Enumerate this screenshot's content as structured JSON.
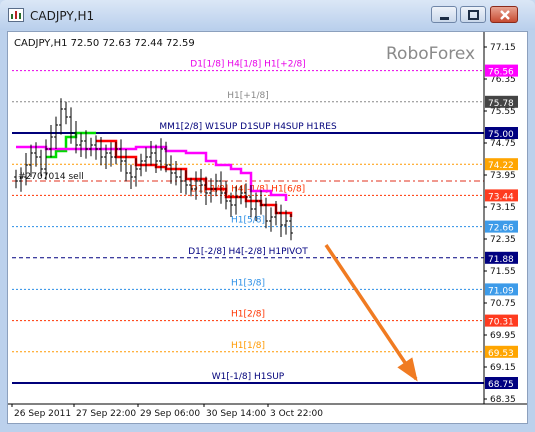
{
  "window": {
    "title": "CADJPY,H1"
  },
  "chart": {
    "symbol_line": "CADJPY,H1  72.50 72.63 72.44 72.59",
    "watermark": "RoboForex",
    "sell_label": "#2707014 sell"
  },
  "chart_data": {
    "type": "line",
    "title": "",
    "ylim": [
      68.1,
      77.4
    ],
    "y_ticks": [
      "77.15",
      "76.35",
      "75.55",
      "74.75",
      "73.95",
      "73.15",
      "72.35",
      "71.55",
      "70.75",
      "69.95",
      "69.15",
      "68.35"
    ],
    "x_ticks": [
      "26 Sep 2011",
      "27 Sep 22:00",
      "29 Sep 06:00",
      "30 Sep 14:00",
      "3 Oct 22:00"
    ],
    "levels": [
      {
        "label": "D1[1/8] H4[1/8] H1[+2/8]",
        "value": 76.56,
        "color": "#e800e8",
        "style": "dotted"
      },
      {
        "label": "H1[+1/8]",
        "value": 75.78,
        "color": "#888888",
        "style": "dotted"
      },
      {
        "label": "MM1[2/8] W1SUP D1SUP H4SUP H1RES",
        "value": 75.0,
        "color": "#00007a",
        "style": "solid"
      },
      {
        "label": "",
        "value": 74.22,
        "color": "#ff9900",
        "style": "dotted"
      },
      {
        "label": "D1[-1/8] H4[-1/8] H1[6/8]",
        "value": 73.44,
        "color": "#ff3300",
        "style": "dotted"
      },
      {
        "label": "H1[5/8]",
        "value": 72.66,
        "color": "#2b8fe6",
        "style": "dotted"
      },
      {
        "label": "D1[-2/8] H4[-2/8] H1PIVOT",
        "value": 71.88,
        "color": "#000080",
        "style": "dashed"
      },
      {
        "label": "H1[3/8]",
        "value": 71.09,
        "color": "#2b8fe6",
        "style": "dotted"
      },
      {
        "label": "H1[2/8]",
        "value": 70.31,
        "color": "#ff3300",
        "style": "dotted"
      },
      {
        "label": "H1[1/8]",
        "value": 69.53,
        "color": "#ff9900",
        "style": "dotted"
      },
      {
        "label": "W1[-1/8] H1SUP",
        "value": 68.75,
        "color": "#00007a",
        "style": "solid"
      }
    ],
    "trade_line": {
      "value": 73.8,
      "color": "#e0301e"
    },
    "price": {
      "close": [
        73.8,
        73.9,
        74.2,
        74.5,
        74.4,
        74.1,
        74.6,
        74.9,
        75.2,
        75.6,
        75.4,
        75.0,
        74.7,
        74.8,
        74.6,
        74.7,
        74.6,
        74.4,
        74.5,
        74.4,
        74.6,
        74.3,
        74.0,
        73.9,
        74.1,
        74.3,
        74.4,
        74.5,
        74.3,
        74.6,
        74.2,
        74.0,
        73.9,
        73.8,
        73.7,
        73.6,
        73.8,
        73.7,
        73.5,
        73.6,
        73.8,
        73.5,
        73.3,
        73.2,
        73.4,
        73.5,
        73.4,
        73.1,
        73.3,
        73.2,
        72.8,
        72.9,
        73.0,
        72.7,
        72.8,
        72.5
      ],
      "color": "#000000"
    },
    "band_magenta": {
      "points": [
        [
          0,
          74.65
        ],
        [
          6,
          74.6
        ],
        [
          12,
          74.6
        ],
        [
          18,
          74.6
        ],
        [
          24,
          74.65
        ],
        [
          30,
          74.55
        ],
        [
          34,
          74.5
        ],
        [
          38,
          74.3
        ],
        [
          40,
          74.2
        ],
        [
          43,
          74.1
        ],
        [
          45,
          74.0
        ],
        [
          47,
          73.55
        ],
        [
          51,
          73.45
        ],
        [
          54,
          73.3
        ]
      ],
      "color": "#ff00ff"
    },
    "band_red": {
      "points": [
        [
          16,
          74.8
        ],
        [
          20,
          74.4
        ],
        [
          24,
          74.2
        ],
        [
          28,
          74.15
        ],
        [
          30,
          74.1
        ],
        [
          34,
          73.85
        ],
        [
          38,
          73.6
        ],
        [
          40,
          73.6
        ],
        [
          42,
          73.4
        ],
        [
          46,
          73.3
        ],
        [
          49,
          73.2
        ],
        [
          52,
          73.0
        ],
        [
          55,
          72.9
        ]
      ],
      "color": "#ff0000"
    },
    "band_green": {
      "points": [
        [
          6,
          74.4
        ],
        [
          8,
          74.55
        ],
        [
          10,
          74.9
        ],
        [
          12,
          75.0
        ],
        [
          14,
          75.0
        ],
        [
          16,
          75.0
        ]
      ],
      "color": "#00dd00"
    },
    "arrow": {
      "from": [
        62,
        72.2
      ],
      "to": [
        80,
        68.85
      ],
      "color": "#f07b22"
    }
  },
  "price_boxes": [
    {
      "value": "76.56",
      "bg": "#ff00ff",
      "fg": "#ffffff"
    },
    {
      "value": "75.78",
      "bg": "#444444",
      "fg": "#ffffff"
    },
    {
      "value": "75.00",
      "bg": "#000080",
      "fg": "#ffffff"
    },
    {
      "value": "74.22",
      "bg": "#ffa500",
      "fg": "#ffffff"
    },
    {
      "value": "73.44",
      "bg": "#ff3b1f",
      "fg": "#ffffff"
    },
    {
      "value": "72.66",
      "bg": "#3d9be9",
      "fg": "#ffffff"
    },
    {
      "value": "71.88",
      "bg": "#000080",
      "fg": "#ffffff"
    },
    {
      "value": "71.09",
      "bg": "#3d9be9",
      "fg": "#ffffff"
    },
    {
      "value": "70.31",
      "bg": "#ff3b1f",
      "fg": "#ffffff"
    },
    {
      "value": "69.53",
      "bg": "#ffa500",
      "fg": "#ffffff"
    },
    {
      "value": "68.75",
      "bg": "#000080",
      "fg": "#ffffff"
    }
  ]
}
